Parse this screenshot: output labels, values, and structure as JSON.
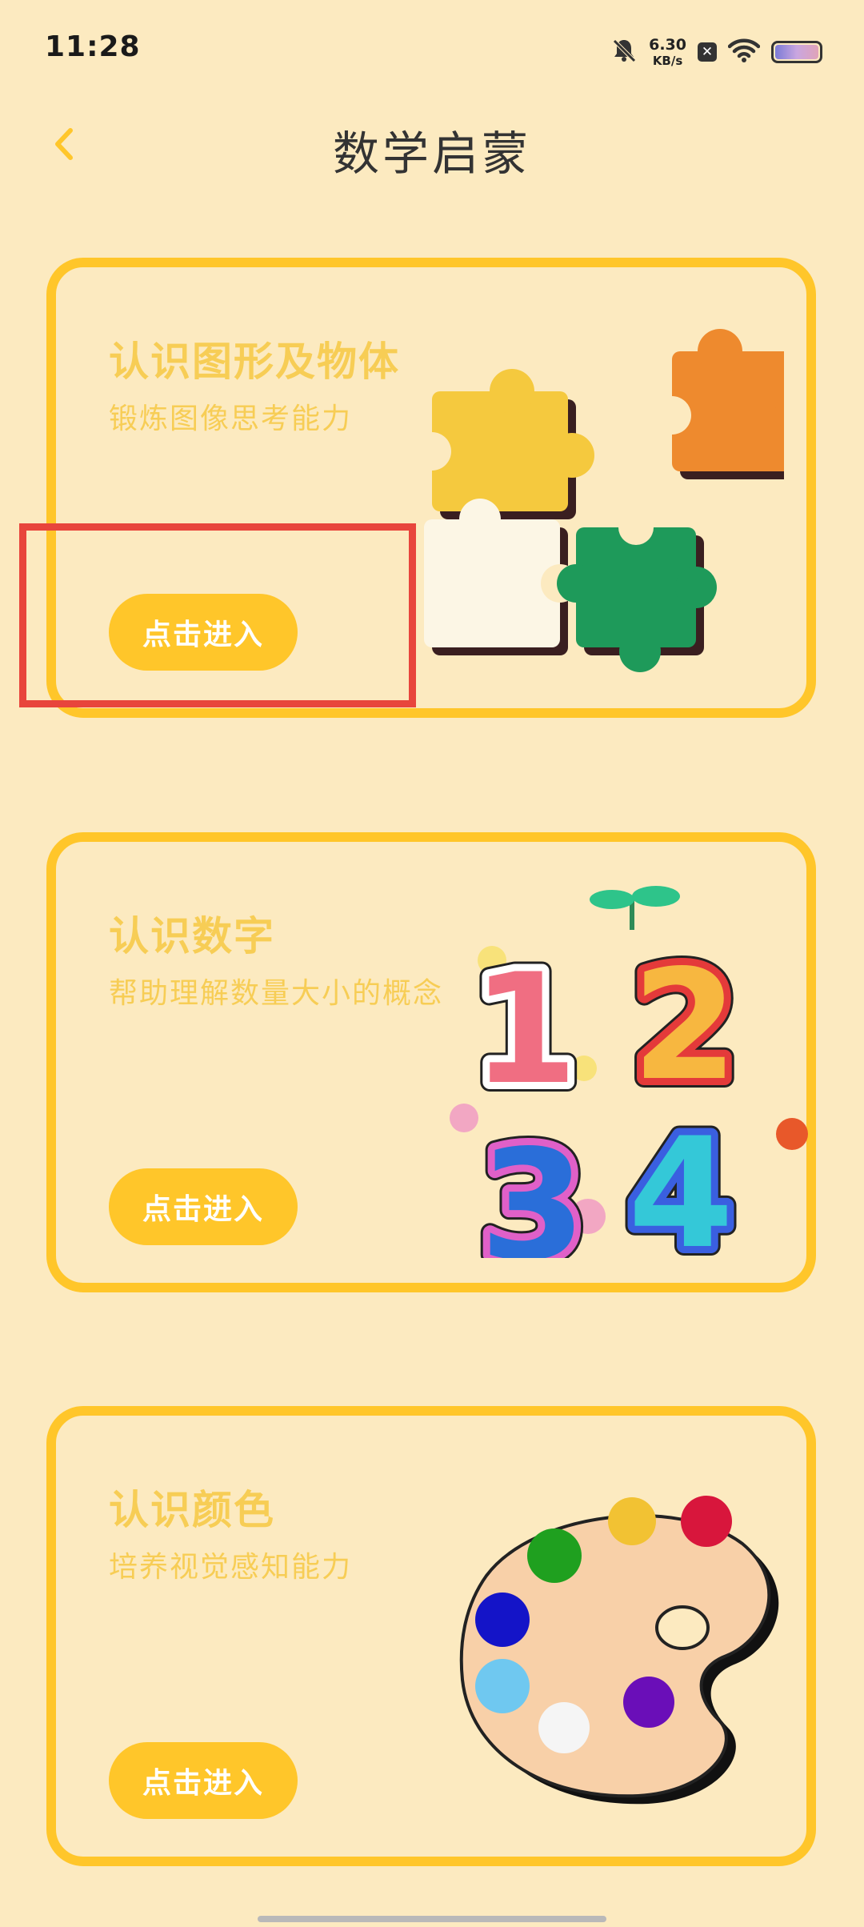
{
  "status_bar": {
    "time": "11:28",
    "net_speed_value": "6.30",
    "net_speed_unit": "KB/s",
    "icons": [
      "bell-mute-icon",
      "close-badge-icon",
      "wifi-icon",
      "battery-icon"
    ]
  },
  "header": {
    "title": "数学启蒙",
    "back_icon": "chevron-left-icon"
  },
  "cards": [
    {
      "title": "认识图形及物体",
      "subtitle": "锻炼图像思考能力",
      "button_label": "点击进入",
      "illustration": "puzzle-pieces-icon"
    },
    {
      "title": "认识数字",
      "subtitle": "帮助理解数量大小的概念",
      "button_label": "点击进入",
      "illustration": "numbers-1234-icon"
    },
    {
      "title": "认识颜色",
      "subtitle": "培养视觉感知能力",
      "button_label": "点击进入",
      "illustration": "paint-palette-icon"
    }
  ],
  "colors": {
    "background": "#FCEAC0",
    "accent": "#FFC62A",
    "card_text": "#F7CD55",
    "highlight": "#E8453C"
  }
}
